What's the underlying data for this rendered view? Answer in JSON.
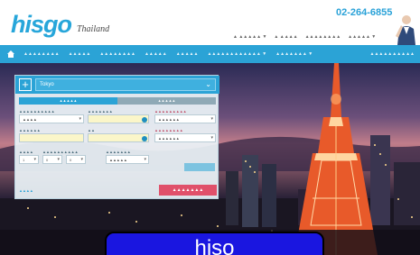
{
  "header": {
    "logo_main": "his",
    "logo_accent": "go",
    "logo_sub": "Thailand",
    "phone": "02-264-6855",
    "top_links": [
      "▲ ▲▲▲▲▲ ▼",
      "▲ ▲▲▲▲",
      "▲▲▲▲▲▲▲▲",
      "▲▲▲▲▲ ▼"
    ]
  },
  "nav": {
    "items": [
      "▲▲▲▲▲▲▲▲",
      "▲▲▲▲▲",
      "▲▲▲▲▲▲▲▲",
      "▲▲▲▲▲",
      "▲▲▲▲▲",
      "▲▲▲▲▲▲▲▲▲▲▲▲ ▼",
      "▲▲▲▲▲▲▲ ▼"
    ],
    "right": "▲▲▲▲▲▲▲▲▲▲"
  },
  "search": {
    "destination": "Tokyo",
    "tabs": [
      "▲▲▲▲▲",
      "▲▲▲▲▲"
    ],
    "fields": {
      "from_label": "▲▲▲▲▲▲▲▲▲▲",
      "from_value": "▲▲▲▲",
      "depart_label": "▲▲▲▲▲▲▲",
      "depart_value": "",
      "class_label": "▲▲▲▲▲▲▲▲▲",
      "class_value": "▲▲▲▲▲▲",
      "return_label": "▲▲▲▲▲▲",
      "return_value": "",
      "date2_label": "▲▲",
      "date2_value": "",
      "type_label": "▲▲▲▲▲▲▲▲",
      "type_value": "▲▲▲▲▲▲",
      "adults_label": "▲▲▲▲",
      "children_label": "▲▲▲▲▲▲▲▲▲▲",
      "infants_label": "▲▲▲▲▲▲▲",
      "adults_value": "1",
      "children_value": "0",
      "infants_value": "0",
      "airline_value": "▲▲▲▲▲"
    },
    "more_link": "▲▲▲▲",
    "submit": "▲▲▲▲▲▲▲"
  },
  "overlay_button": "hiso"
}
